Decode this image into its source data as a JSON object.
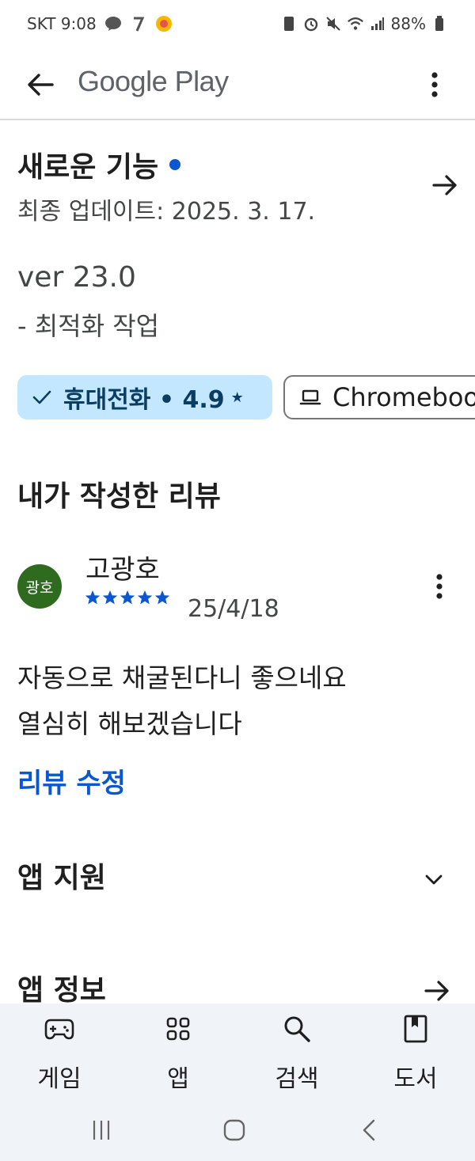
{
  "status_bar": {
    "carrier_time": "SKT 9:08",
    "battery": "88%"
  },
  "app_bar": {
    "title": "Google Play"
  },
  "whats_new": {
    "title": "새로운 기능",
    "updated": "최종 업데이트: 2025. 3. 17.",
    "version": "ver 23.0",
    "note": "- 최적화 작업"
  },
  "chips": {
    "phone_label": "휴대전화 • 4.9",
    "phone_star": "★",
    "chromebook_label": "Chromebook"
  },
  "my_review": {
    "heading": "내가 작성한 리뷰",
    "avatar_text": "광호",
    "name": "고광호",
    "rating": 5,
    "date": "25/4/18",
    "text_line1": "자동으로 채굴된다니 좋으네요",
    "text_line2": "열심히 해보겠습니다",
    "edit_label": "리뷰 수정"
  },
  "sections": {
    "support": "앱 지원",
    "info": "앱 정보"
  },
  "bottom_nav": {
    "games": "게임",
    "apps": "앱",
    "search": "검색",
    "books": "도서"
  },
  "colors": {
    "accent": "#0b57d0",
    "chip_selected_bg": "#c2e7ff",
    "avatar_bg": "#2e6b1f",
    "nav_bg": "#f0f4f9"
  }
}
